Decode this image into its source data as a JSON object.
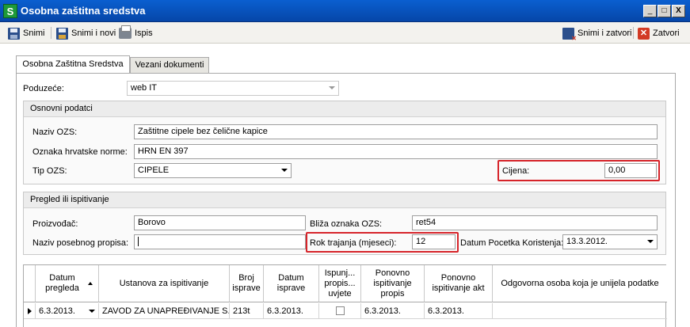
{
  "window": {
    "title": "Osobna zaštitna sredstva",
    "app_icon": "S"
  },
  "titlebar_buttons": {
    "minimize": "_",
    "maximize": "□",
    "close": "X"
  },
  "toolbar": {
    "save_label": "Snimi",
    "save_new_label": "Snimi i novi",
    "print_label": "Ispis",
    "save_close_label": "Snimi i zatvori",
    "close_label": "Zatvori"
  },
  "tabs": [
    {
      "label": "Osobna Zaštitna Sredstva",
      "active": true
    },
    {
      "label": "Vezani dokumenti",
      "active": false
    }
  ],
  "company": {
    "label": "Poduzeće:",
    "value": "web IT"
  },
  "basic": {
    "header": "Osnovni podatci",
    "name_label": "Naziv OZS:",
    "name_value": "Zaštitne cipele bez čelične kapice",
    "norm_label": "Oznaka hrvatske norme:",
    "norm_value": "HRN EN 397",
    "type_label": "Tip OZS:",
    "type_value": "CIPELE",
    "price_label": "Cijena:",
    "price_value": "0,00"
  },
  "review": {
    "header": "Pregled ili ispitivanje",
    "manufacturer_label": "Proizvođač:",
    "manufacturer_value": "Borovo",
    "closer_label": "Bliža oznaka OZS:",
    "closer_value": "ret54",
    "regulation_label": "Naziv posebnog propisa:",
    "regulation_value": "",
    "duration_label": "Rok trajanja (mjeseci):",
    "duration_value": "12",
    "start_date_label": "Datum Pocetka Koristenja:",
    "start_date_value": "13.3.2012."
  },
  "grid": {
    "columns": [
      "Datum pregleda",
      "Ustanova za ispitivanje",
      "Broj isprave",
      "Datum isprave",
      "Ispunj... propis... uvjete",
      "Ponovno ispitivanje propis",
      "Ponovno ispitivanje akt",
      "Odgovorna osoba koja je unijela podatke"
    ],
    "rows": [
      [
        "6.3.2013.",
        "ZAVOD ZA UNAPREĐIVANJE S...",
        "213t",
        "6.3.2013.",
        "",
        "6.3.2013.",
        "6.3.2013.",
        ""
      ]
    ]
  },
  "colors": {
    "highlight": "#d6242a",
    "titlebar": "#0a5fd0"
  }
}
